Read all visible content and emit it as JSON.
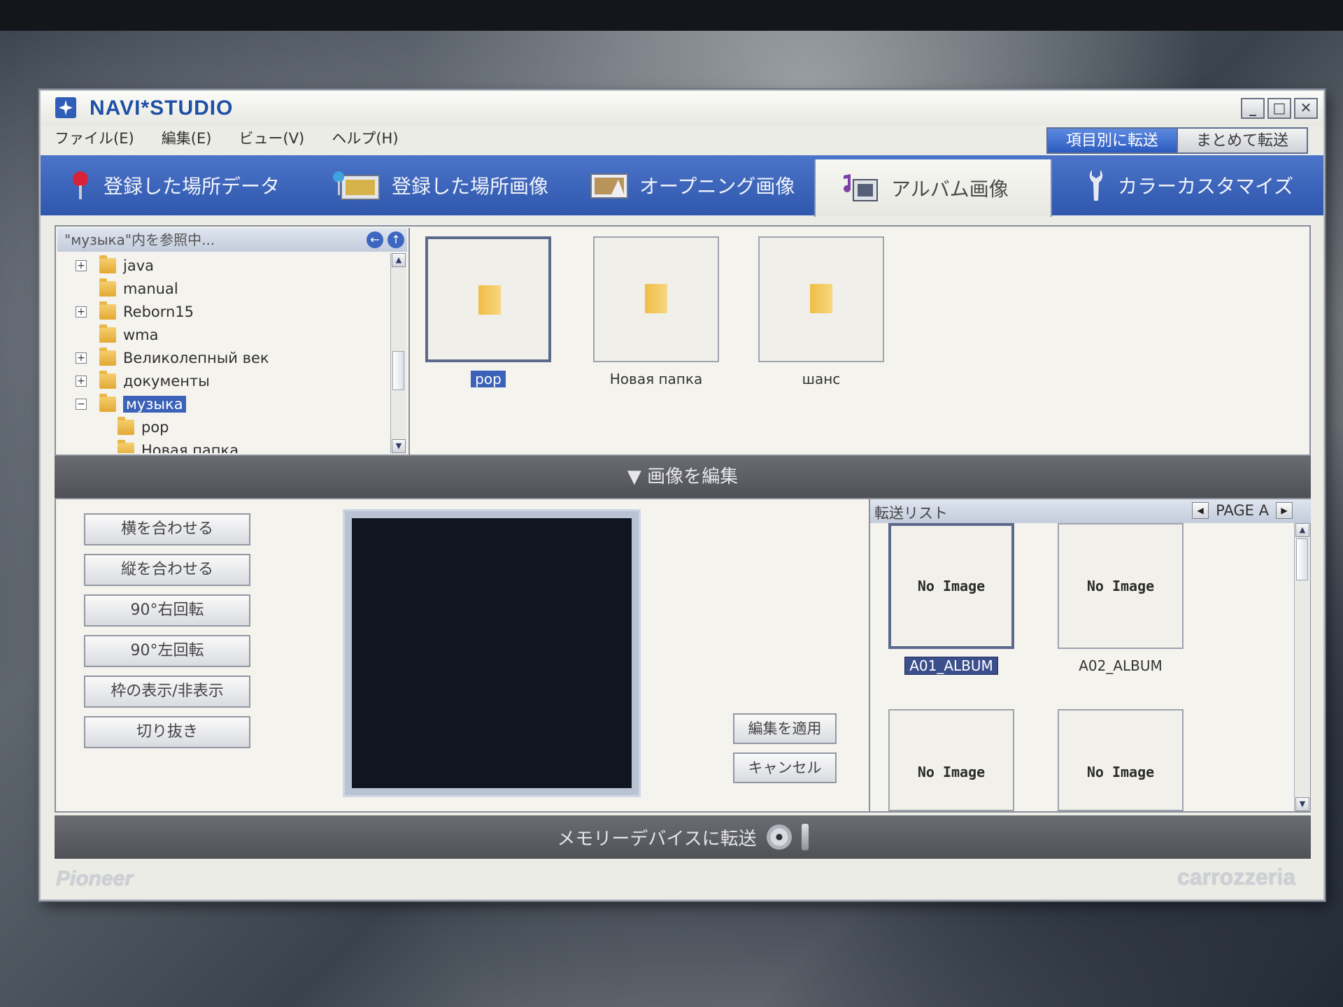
{
  "app": {
    "title": "NAVI*STUDIO",
    "menu": [
      "ファイル(E)",
      "編集(E)",
      "ビュー(V)",
      "ヘルプ(H)"
    ],
    "transfer_modes": {
      "by_item": "項目別に転送",
      "all": "まとめて転送"
    }
  },
  "tabs": [
    {
      "label": "登録した場所データ",
      "icon": "map-pin-icon",
      "active": false
    },
    {
      "label": "登録した場所画像",
      "icon": "pin-photo-icon",
      "active": false
    },
    {
      "label": "オープニング画像",
      "icon": "picture-icon",
      "active": false
    },
    {
      "label": "アルバム画像",
      "icon": "music-album-icon",
      "active": true
    },
    {
      "label": "カラーカスタマイズ",
      "icon": "wrench-icon",
      "active": false
    }
  ],
  "browser": {
    "header": "\"музыка\"内を参照中...",
    "tree": [
      {
        "label": "java",
        "expander": "+",
        "level": 0
      },
      {
        "label": "manual",
        "expander": "",
        "level": 0
      },
      {
        "label": "Reborn15",
        "expander": "+",
        "level": 0
      },
      {
        "label": "wma",
        "expander": "",
        "level": 0
      },
      {
        "label": "Великолепный век",
        "expander": "+",
        "level": 0
      },
      {
        "label": "документы",
        "expander": "+",
        "level": 0
      },
      {
        "label": "музыка",
        "expander": "−",
        "level": 0,
        "selected": true
      },
      {
        "label": "pop",
        "expander": "",
        "level": 1
      },
      {
        "label": "Новая папка",
        "expander": "",
        "level": 1
      }
    ],
    "thumbnails": [
      {
        "label": "pop",
        "selected": true
      },
      {
        "label": "Новая папка",
        "selected": false
      },
      {
        "label": "шанс",
        "selected": false
      }
    ]
  },
  "edit": {
    "bar_label": "画像を編集",
    "buttons": [
      "横を合わせる",
      "縦を合わせる",
      "90°右回転",
      "90°左回転",
      "枠の表示/非表示",
      "切り抜き"
    ],
    "apply": "編集を適用",
    "cancel": "キャンセル"
  },
  "transfer_list": {
    "title": "転送リスト",
    "page": "PAGE A",
    "items": [
      {
        "image": "No Image",
        "label": "A01_ALBUM",
        "selected": true
      },
      {
        "image": "No Image",
        "label": "A02_ALBUM",
        "selected": false
      },
      {
        "image": "No Image",
        "label": "",
        "selected": false
      },
      {
        "image": "No Image",
        "label": "",
        "selected": false
      }
    ]
  },
  "memory_bar_label": "メモリーデバイスに転送",
  "brands": {
    "left": "Pioneer",
    "right": "carrozzeria"
  },
  "colors": {
    "accent": "#3b62b8",
    "tabbar": "#3a63bb",
    "folder": "#e9b545"
  }
}
